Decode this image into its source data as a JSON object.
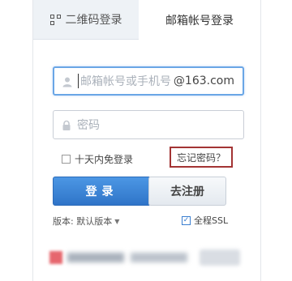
{
  "tabs": {
    "qr_label": "二维码登录",
    "mail_label": "邮箱帐号登录"
  },
  "account": {
    "placeholder": "邮箱帐号或手机号",
    "suffix": "@163.com"
  },
  "password": {
    "placeholder": "密码"
  },
  "remember_label": "十天内免登录",
  "forgot_label": "忘记密码？",
  "login_label": "登录",
  "register_label": "去注册",
  "version": {
    "label": "版本: 默认版本"
  },
  "ssl_label": "全程SSL",
  "colors": {
    "primary": "#2f74c8",
    "highlight_box": "#a33434"
  }
}
